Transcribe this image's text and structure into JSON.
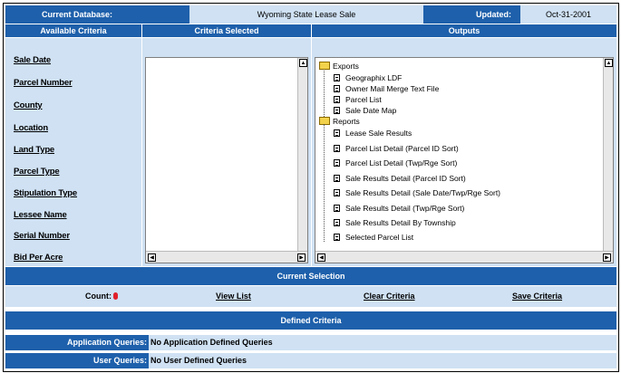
{
  "header": {
    "db_label": "Current Database:",
    "db_value": "Wyoming State Lease Sale",
    "updated_label": "Updated:",
    "updated_value": "Oct-31-2001"
  },
  "columns": {
    "available": "Available Criteria",
    "selected": "Criteria Selected",
    "outputs": "Outputs"
  },
  "criteria": [
    "Sale Date",
    "Parcel Number",
    "County",
    "Location",
    "Land Type",
    "Parcel Type",
    "Stipulation Type",
    "Lessee Name",
    "Serial Number",
    "Bid Per Acre"
  ],
  "outputs": {
    "exports_label": "Exports",
    "exports": [
      "Geographix LDF",
      "Owner Mail Merge Text File",
      "Parcel List",
      "Sale Date Map"
    ],
    "reports_label": "Reports",
    "reports": [
      "Lease Sale Results",
      "Parcel List Detail (Parcel ID Sort)",
      "Parcel List Detail (Twp/Rge Sort)",
      "Sale Results Detail (Parcel ID Sort)",
      "Sale Results Detail (Sale Date/Twp/Rge Sort)",
      "Sale Results Detail (Twp/Rge Sort)",
      "Sale Results Detail By Township",
      "Selected Parcel List"
    ]
  },
  "current_selection": {
    "title": "Current Selection",
    "count_label": "Count:",
    "count_value": "0",
    "view_list": "View List",
    "clear_criteria": "Clear Criteria",
    "save_criteria": "Save Criteria"
  },
  "defined_criteria": {
    "title": "Defined Criteria",
    "app_label": "Application Queries:",
    "app_value": "No Application Defined Queries",
    "user_label": "User Queries:",
    "user_value": "No User Defined Queries"
  },
  "colors": {
    "band": "#1e60ab",
    "pale": "#cfe1f3",
    "count_dot": "#e0202a"
  }
}
